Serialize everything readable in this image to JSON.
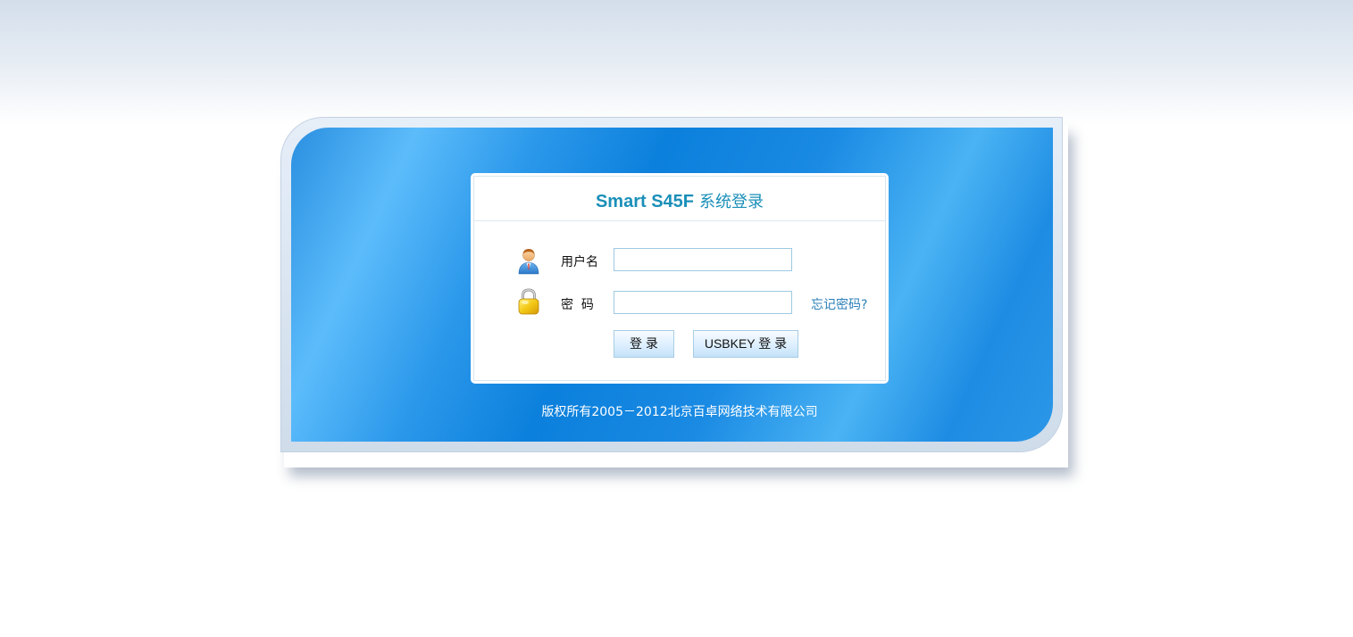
{
  "login": {
    "title_en": "Smart S45F",
    "title_cn": "系统登录",
    "username_label": "用户名",
    "username_value": "",
    "password_label": "密  码",
    "password_value": "",
    "forgot_link": "忘记密码?",
    "login_button": "登 录",
    "usbkey_button": "USBKEY 登 录"
  },
  "footer": {
    "copyright": "版权所有2005－2012北京百卓网络技术有限公司"
  },
  "icons": {
    "user": "user-icon",
    "lock": "lock-icon"
  },
  "colors": {
    "title": "#1a8fb8",
    "panel_blue": "#0b80dc",
    "link": "#2a7fb8",
    "input_border": "#9ec9e3"
  }
}
